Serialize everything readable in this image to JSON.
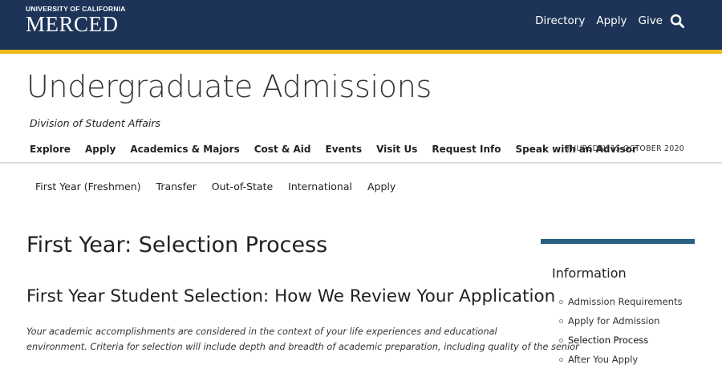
{
  "header": {
    "logo": {
      "line1": "UNIVERSITY OF CALIFORNIA",
      "line2": "MERCED"
    },
    "utility_links": [
      "Directory",
      "Apply",
      "Give"
    ],
    "search_icon": "search-icon",
    "colors": {
      "bar": "#1d3458",
      "accent": "#f1b81c"
    }
  },
  "site": {
    "title": "Undergraduate Admissions",
    "division": "Division of Student Affairs",
    "nav": [
      "Explore",
      "Apply",
      "Academics & Majors",
      "Cost & Aid",
      "Events",
      "Visit Us",
      "Request Info",
      "Speak with an Advisor"
    ],
    "date": "THURSDAY 15 OCTOBER 2020"
  },
  "subnav": [
    "First Year (Freshmen)",
    "Transfer",
    "Out-of-State",
    "International",
    "Apply"
  ],
  "main": {
    "page_title": "First Year: Selection Process",
    "section_title": "First Year Student Selection: How We Review Your Application",
    "body_line1": "Your academic accomplishments are considered in the context of your life experiences and educational",
    "body_line2": "environment. Criteria for selection will include depth and breadth of academic preparation, including quality of the senior"
  },
  "sidebar": {
    "heading": "Information",
    "items": [
      "Admission Requirements",
      "Apply for Admission",
      "Selection Process",
      "After You Apply"
    ],
    "active_index": 2,
    "accent": "#255f82"
  }
}
